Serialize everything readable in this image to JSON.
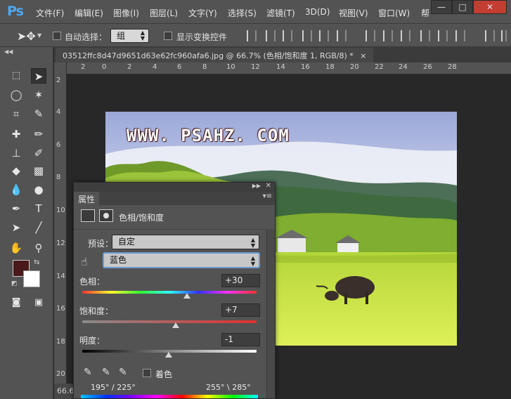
{
  "app": {
    "logo": "Ps"
  },
  "menu": [
    "文件(F)",
    "编辑(E)",
    "图像(I)",
    "图层(L)",
    "文字(Y)",
    "选择(S)",
    "滤镜(T)",
    "3D(D)",
    "视图(V)",
    "窗口(W)",
    "帮"
  ],
  "window_controls": {
    "minimize": "—",
    "maximize": "□",
    "close": "✕"
  },
  "options": {
    "auto_select_label": "自动选择：",
    "auto_select_value": "组",
    "show_transform_label": "显示变换控件"
  },
  "document": {
    "tab_title": "03512ffc8d47d9651d63e62fc960afa6.jpg @ 66.7% (色相/饱和度 1, RGB/8) *",
    "tab_close": "×",
    "zoom": "66.67",
    "watermark": "WWW. PSAHZ. COM"
  },
  "ruler": {
    "h": [
      "2",
      "0",
      "2",
      "4",
      "6",
      "8",
      "10",
      "12",
      "14",
      "16",
      "18",
      "20",
      "22",
      "24",
      "26",
      "28"
    ],
    "v": [
      "2",
      "4",
      "6",
      "8",
      "10",
      "12",
      "14",
      "16",
      "18",
      "20"
    ]
  },
  "colors": {
    "foreground": "#4a1a1a",
    "background": "#ffffff",
    "panel_bg": "#535353"
  },
  "properties": {
    "panel_title": "属性",
    "adjustment_name": "色相/饱和度",
    "preset_label": "预设：",
    "preset_value": "自定",
    "channel_value": "蓝色",
    "hue_label": "色相：",
    "hue_value": "+30",
    "hue_level": 0.6,
    "saturation_label": "饱和度：",
    "saturation_value": "+7",
    "saturation_level": 0.535,
    "lightness_label": "明度：",
    "lightness_value": "-1",
    "lightness_level": 0.495,
    "colorize_label": "着色",
    "range_left": "195° / 225°",
    "range_right": "255° \\ 285°"
  }
}
